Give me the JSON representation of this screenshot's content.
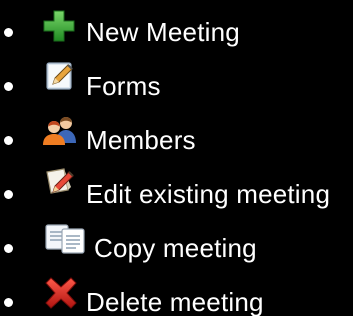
{
  "menu": {
    "items": [
      {
        "label": "New Meeting",
        "icon": "plus-icon",
        "icon_color": "#3fae3a"
      },
      {
        "label": "Forms",
        "icon": "pencil-document-icon",
        "icon_color": "#b7c9d9"
      },
      {
        "label": "Members",
        "icon": "members-icon",
        "icon_color": "#4a6fb5"
      },
      {
        "label": "Edit existing meeting",
        "icon": "edit-icon",
        "icon_color": "#d9b36b"
      },
      {
        "label": "Copy meeting",
        "icon": "copy-icon",
        "icon_color": "#e6ebf2"
      },
      {
        "label": "Delete meeting",
        "icon": "delete-icon",
        "icon_color": "#d6201c"
      }
    ]
  },
  "colors": {
    "background": "#000000",
    "text": "#ffffff"
  }
}
